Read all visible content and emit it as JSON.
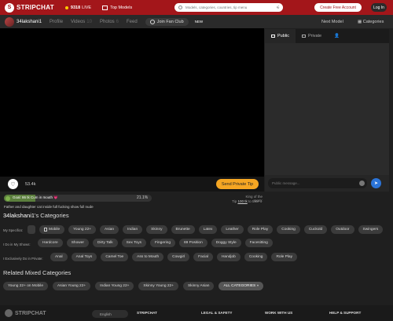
{
  "header": {
    "brand": "STRIPCHAT",
    "live_count": "9318",
    "live_label": "LIVE",
    "top_models": "Top Models",
    "search_placeholder": "Models, categories, countries, tip menu",
    "create_account": "Create Free Account",
    "login": "Log In"
  },
  "subnav": {
    "username": "34lakshani1",
    "tabs": [
      {
        "label": "Profile"
      },
      {
        "label": "Videos",
        "count": "10"
      },
      {
        "label": "Photos",
        "count": "6"
      },
      {
        "label": "Feed"
      }
    ],
    "fan_club": "Join Fan Club",
    "new_tag": "NEW",
    "next_model": "Next Model",
    "categories": "Categories"
  },
  "chat": {
    "tabs": [
      "Public",
      "Private"
    ],
    "input_placeholder": "Public message..."
  },
  "player": {
    "likes": "53.4k",
    "send_tip": "Send Private Tip"
  },
  "goal": {
    "text": "Goal: 86 tk Cum in mouth 💗",
    "percent": "21.1%",
    "progress": 0.211
  },
  "king": {
    "line1": "King of the room:",
    "tip_prefix": "Tip",
    "tip_amount": "100 tk",
    "tip_suffix": "to take it"
  },
  "topic": "Father and daughter cat inside full fucking show full nude",
  "categories": {
    "title_user": "34lakshani1",
    "title_suffix": "'s Categories",
    "rows": [
      {
        "label": "My Specifics:",
        "chips": [
          "Mobile",
          "Young 22+",
          "Asian",
          "Indian",
          "Skinny",
          "Brunette",
          "Latex",
          "Leather",
          "Role Play",
          "Cooking",
          "Cuckold",
          "Outdoor",
          "Swingers"
        ]
      },
      {
        "label": "I Do in My Shows:",
        "chips": [
          "Hardcore",
          "Shower",
          "Dirty Talk",
          "Sex Toys",
          "Fingering",
          "69 Position",
          "Doggy Style",
          "Facesitting"
        ]
      },
      {
        "label": "I Exclusively Do in Private:",
        "chips": [
          "Anal",
          "Anal Toys",
          "Camel Toe",
          "Ass to Mouth",
          "Cowgirl",
          "Facial",
          "Handjob",
          "Cooking",
          "Role Play"
        ]
      }
    ]
  },
  "related": {
    "title": "Related Mixed Categories",
    "chips": [
      "Young 22+ on Mobile",
      "Asian Young 22+",
      "Indian Young 22+",
      "Skinny Young 22+",
      "Skinny Asian",
      "ALL CATEGORIES »"
    ]
  },
  "footer": {
    "brand": "STRIPCHAT",
    "language": "English",
    "columns": [
      "STRIPCHAT",
      "LEGAL & SAFETY",
      "WORK WITH US",
      "HELP & SUPPORT"
    ]
  }
}
